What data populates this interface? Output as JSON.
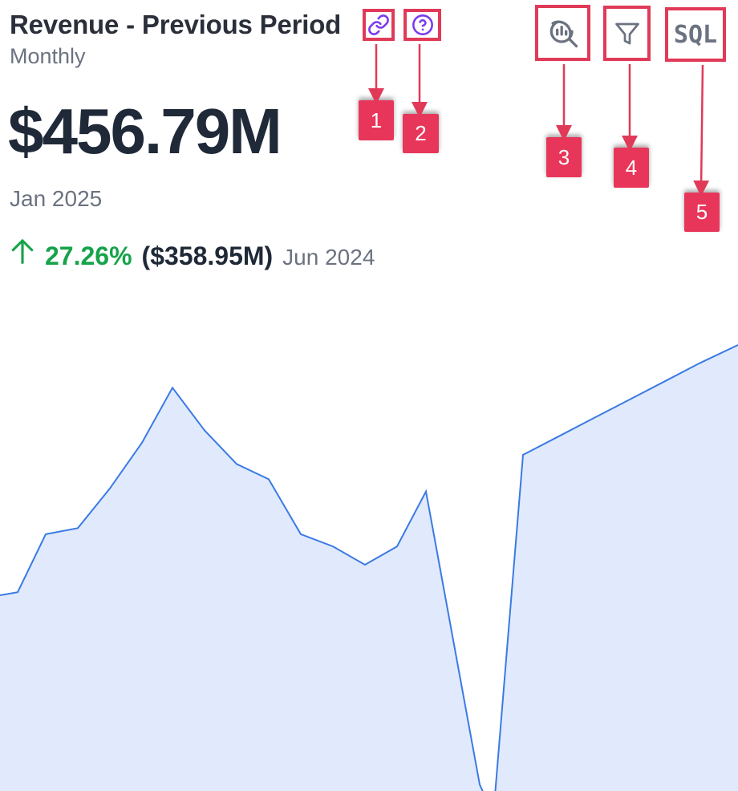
{
  "header": {
    "title": "Revenue - Previous Period",
    "subtitle": "Monthly",
    "link_icon": "link-icon",
    "help_icon": "help-circle-icon"
  },
  "metric": {
    "value": "$456.79M",
    "date": "Jan 2025",
    "change_percent": "27.26%",
    "previous_value": "($358.95M)",
    "previous_date": "Jun 2024",
    "trend_icon": "arrow-up-icon"
  },
  "toolbar": {
    "explore_icon": "explore-chart-icon",
    "filter_icon": "funnel-icon",
    "sql_label": "SQL"
  },
  "annotations": {
    "badge_1": "1",
    "badge_2": "2",
    "badge_3": "3",
    "badge_4": "4",
    "badge_5": "5"
  },
  "colors": {
    "accent": "#7c3aed",
    "positive": "#16a34a",
    "line": "#3b7ae3",
    "area": "#e0eafc",
    "annotation": "#e8365a"
  },
  "chart_data": {
    "type": "area",
    "values": [
      12,
      13,
      32,
      34,
      47,
      62,
      80,
      66,
      55,
      50,
      32,
      28,
      22,
      28,
      46,
      -50,
      -60,
      58,
      64,
      70,
      76,
      82,
      88,
      94
    ]
  }
}
